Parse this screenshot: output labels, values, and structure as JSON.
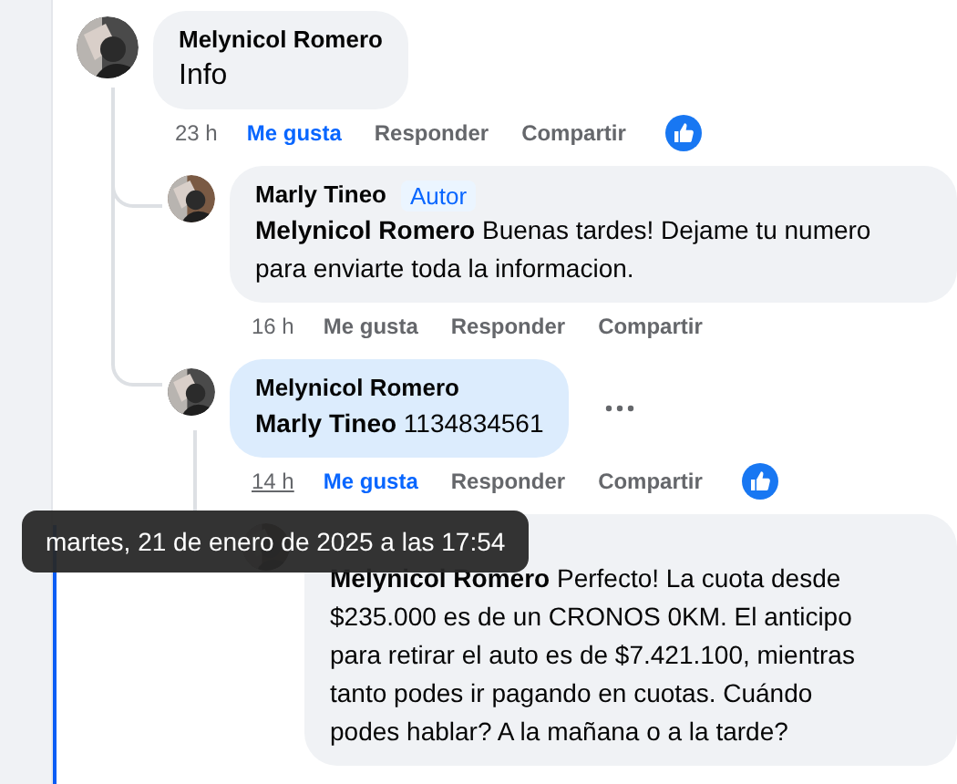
{
  "comments": [
    {
      "author": "Melynicol Romero",
      "body": "Info",
      "highlighted": false,
      "show_menu": false,
      "time": "23 h",
      "time_hovered": false,
      "like": "Me gusta",
      "liked": true,
      "reply": "Responder",
      "share": "Compartir",
      "has_reaction": true,
      "replies": [
        {
          "author": "Marly Tineo",
          "badge": "Autor",
          "body": "**Melynicol Romero** Buenas tardes! Dejame tu numero para enviarte toda la informacion.",
          "highlighted": false,
          "show_menu": false,
          "time": "16 h",
          "time_hovered": false,
          "like": "Me gusta",
          "liked": false,
          "reply": "Responder",
          "share": "Compartir",
          "has_reaction": false
        },
        {
          "author": "Melynicol Romero",
          "body": "**Marly Tineo** 1134834561",
          "highlighted": true,
          "show_menu": true,
          "time": "14 h",
          "time_hovered": true,
          "like": "Me gusta",
          "liked": true,
          "reply": "Responder",
          "share": "Compartir",
          "has_reaction": true,
          "replies": [
            {
              "body": "**Melynicol Romero** Perfecto! La cuota desde $235.000 es de un CRONOS 0KM. El anticipo para retirar el auto es de $7.421.100, mientras tanto podes ir pagando en cuotas. Cuándo podes hablar? A la mañana o a la tarde?",
              "highlighted": false,
              "show_menu": false
            }
          ]
        }
      ]
    }
  ],
  "tooltip": "martes, 21 de enero de 2025 a las 17:54"
}
